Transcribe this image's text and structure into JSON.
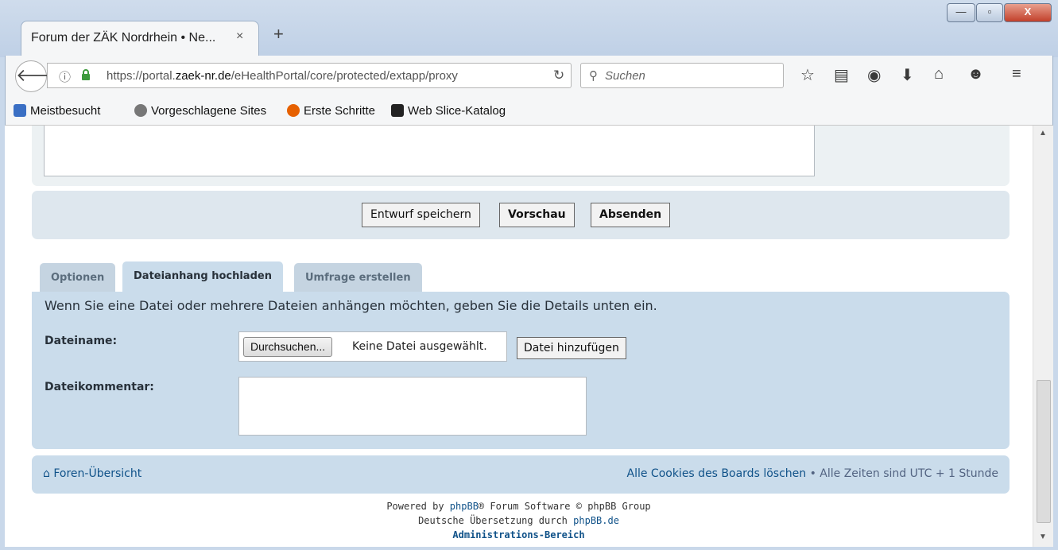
{
  "browser": {
    "tab_title": "Forum der ZÄK Nordrhein • Ne...",
    "tab_close": "×",
    "new_tab": "+",
    "window_buttons": {
      "minimize": "—",
      "maximize": "▫",
      "close": "X"
    },
    "url_prefix": "https://portal.",
    "url_domain": "zaek-nr.de",
    "url_path": "/eHealthPortal/core/protected/extapp/proxy",
    "search_placeholder": "Suchen",
    "bookmarks": [
      {
        "label": "Meistbesucht",
        "icon": "search-bookmark-icon",
        "color": "#3a6fc4"
      },
      {
        "label": "Vorgeschlagene Sites",
        "icon": "globe-icon",
        "color": "#777777"
      },
      {
        "label": "Erste Schritte",
        "icon": "firefox-icon",
        "color": "#e66000"
      },
      {
        "label": "Web Slice-Katalog",
        "icon": "webslice-icon",
        "color": "#222222"
      }
    ]
  },
  "form": {
    "buttons": {
      "save_draft": "Entwurf speichern",
      "preview": "Vorschau",
      "submit": "Absenden"
    },
    "tabs": [
      {
        "label": "Optionen",
        "active": false
      },
      {
        "label": "Dateianhang hochladen",
        "active": true
      },
      {
        "label": "Umfrage erstellen",
        "active": false
      }
    ],
    "attachment": {
      "info": "Wenn Sie eine Datei oder mehrere Dateien anhängen möchten, geben Sie die Details unten ein.",
      "filename_label": "Dateiname:",
      "browse_label": "Durchsuchen...",
      "no_file": "Keine Datei ausgewählt.",
      "add_file": "Datei hinzufügen",
      "comment_label": "Dateikommentar:"
    }
  },
  "footer": {
    "home_link": "Foren-Übersicht",
    "delete_cookies": "Alle Cookies des Boards löschen",
    "separator": " • ",
    "timezone": "Alle Zeiten sind UTC + 1 Stunde",
    "powered_by": "Powered by ",
    "phpbb": "phpBB",
    "powered_rest": "® Forum Software © phpBB Group",
    "translation": "Deutsche Übersetzung durch ",
    "phpbb_de": "phpBB.de",
    "admin": "Administrations-Bereich"
  }
}
